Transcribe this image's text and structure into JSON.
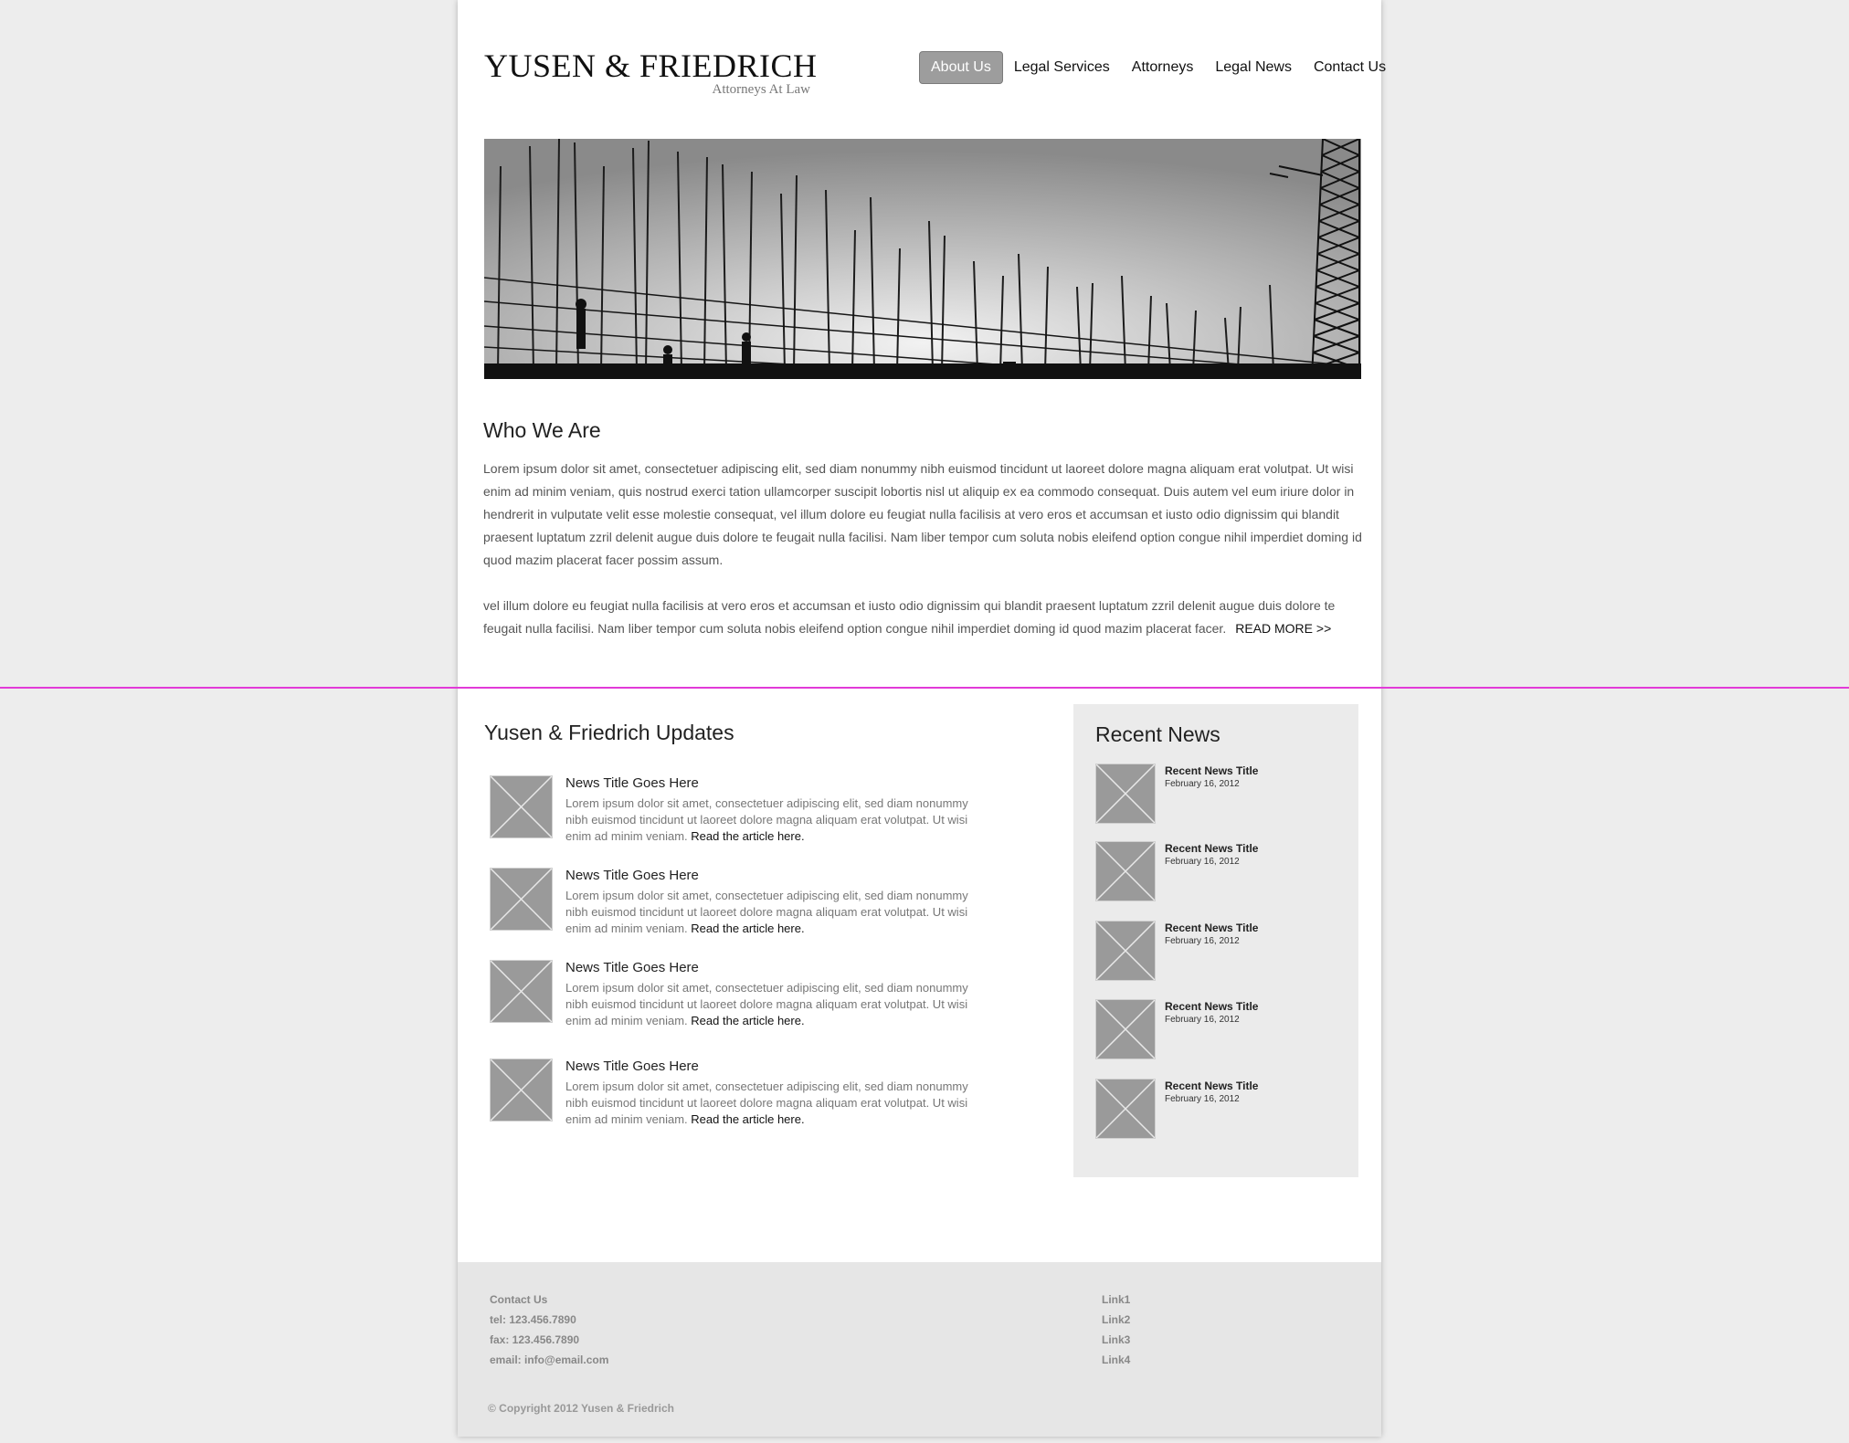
{
  "header": {
    "logo_title": "YUSEN & FRIEDRICH",
    "logo_subtitle": "Attorneys At Law",
    "nav": [
      {
        "label": "About Us",
        "active": true
      },
      {
        "label": "Legal Services",
        "active": false
      },
      {
        "label": "Attorneys",
        "active": false
      },
      {
        "label": "Legal News",
        "active": false
      },
      {
        "label": "Contact Us",
        "active": false
      }
    ]
  },
  "hero": {
    "icon": "construction-scaffolding-photo"
  },
  "who": {
    "title": "Who We Are",
    "paragraph1": "Lorem ipsum dolor sit amet, consectetuer adipiscing elit, sed diam nonummy nibh euismod tincidunt ut laoreet dolore magna aliquam erat volutpat. Ut wisi enim ad minim veniam, quis nostrud exerci tation ullamcorper suscipit lobortis nisl ut aliquip ex ea commodo consequat. Duis autem vel eum iriure dolor in hendrerit in vulputate velit esse molestie consequat, vel illum dolore eu feugiat nulla facilisis at vero eros et accumsan et iusto odio dignissim qui blandit praesent luptatum zzril delenit augue duis dolore te feugait nulla facilisi. Nam liber tempor cum soluta nobis eleifend option congue nihil imperdiet doming id quod mazim placerat facer possim assum.",
    "paragraph2": "vel illum dolore eu feugiat nulla facilisis at vero eros et accumsan et iusto odio dignissim qui blandit praesent luptatum zzril delenit augue duis dolore te feugait nulla facilisi. Nam liber tempor cum soluta nobis eleifend option congue nihil imperdiet doming id quod mazim placerat facer.",
    "read_more": "READ MORE >>"
  },
  "updates": {
    "title": "Yusen & Friedrich Updates",
    "items": [
      {
        "title": "News Title Goes Here",
        "body": "Lorem ipsum dolor sit amet, consectetuer adipiscing elit, sed diam nonummy nibh euismod tincidunt ut laoreet dolore magna aliquam erat volutpat. Ut wisi enim ad minim veniam.",
        "link": "Read the article here."
      },
      {
        "title": "News Title Goes Here",
        "body": "Lorem ipsum dolor sit amet, consectetuer adipiscing elit, sed diam nonummy nibh euismod tincidunt ut laoreet dolore magna aliquam erat volutpat. Ut wisi enim ad minim veniam.",
        "link": "Read the article here."
      },
      {
        "title": "News Title Goes Here",
        "body": "Lorem ipsum dolor sit amet, consectetuer adipiscing elit, sed diam nonummy nibh euismod tincidunt ut laoreet dolore magna aliquam erat volutpat. Ut wisi enim ad minim veniam.",
        "link": "Read the article here."
      },
      {
        "title": "News Title Goes Here",
        "body": "Lorem ipsum dolor sit amet, consectetuer adipiscing elit, sed diam nonummy nibh euismod tincidunt ut laoreet dolore magna aliquam erat volutpat. Ut wisi enim ad minim veniam.",
        "link": "Read the article here."
      }
    ]
  },
  "recent": {
    "title": "Recent News",
    "items": [
      {
        "title": "Recent News Title",
        "date": "February 16, 2012"
      },
      {
        "title": "Recent News Title",
        "date": "February 16, 2012"
      },
      {
        "title": "Recent News Title",
        "date": "February 16, 2012"
      },
      {
        "title": "Recent News Title",
        "date": "February 16, 2012"
      },
      {
        "title": "Recent News Title",
        "date": "February 16, 2012"
      }
    ]
  },
  "footer": {
    "contact_heading": "Contact Us",
    "tel": "tel: 123.456.7890",
    "fax": "fax: 123.456.7890",
    "email": "email: info@email.com",
    "links": [
      "Link1",
      "Link2",
      "Link3",
      "Link4"
    ],
    "copyright": "© Copyright 2012 Yusen & Friedrich"
  },
  "colors": {
    "page_bg": "#ededed",
    "nav_active_bg": "#9d9d9d",
    "placeholder_gray": "#9a9a9a",
    "guide_line": "#e23ad8"
  }
}
